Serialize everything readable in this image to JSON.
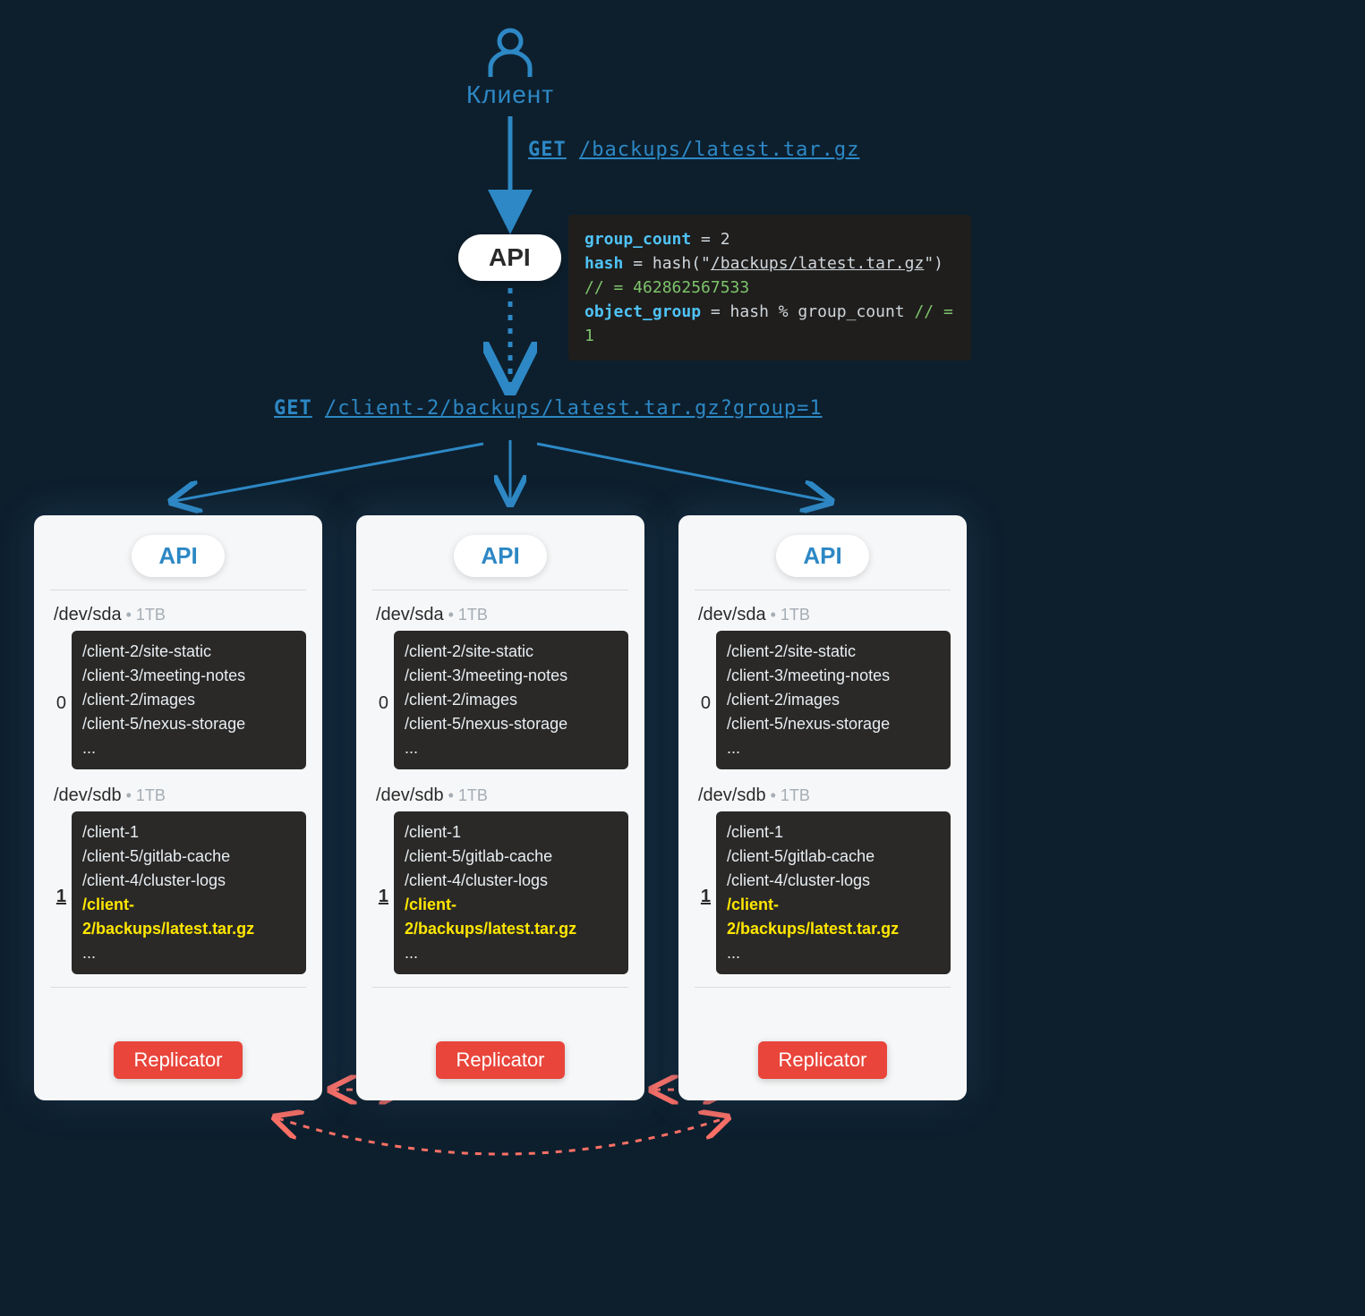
{
  "client": {
    "label": "Клиент"
  },
  "request1": {
    "method": "GET",
    "path": "/backups/latest.tar.gz"
  },
  "code": {
    "l1k": "group_count",
    "l1v": " = 2",
    "l2k": "hash",
    "l2a": " = hash(\"",
    "l2p": "/backups/latest.tar.gz",
    "l2b": "\") ",
    "l2c": "// = 462862567533",
    "l3k": "object_group",
    "l3v": " = hash % group_count  ",
    "l3c": "// = 1"
  },
  "api_top": "API",
  "request2": {
    "method": "GET",
    "path": "/client-2/backups/latest.tar.gz?group=1"
  },
  "node": {
    "api": "API",
    "devA": {
      "name": "/dev/sda",
      "size": " • 1TB"
    },
    "devB": {
      "name": "/dev/sdb",
      "size": " • 1TB"
    },
    "grp0_idx": "0",
    "grp0": {
      "r1": "/client-2/site-static",
      "r2": "/client-3/meeting-notes",
      "r3": "/client-2/images",
      "r4": "/client-5/nexus-storage",
      "r5": "..."
    },
    "grp1_idx": "1",
    "grp1": {
      "r1": "/client-1",
      "r2": "/client-5/gitlab-cache",
      "r3": "/client-4/cluster-logs",
      "r4": "/client-2/backups/latest.tar.gz",
      "r5": "..."
    },
    "replicator": "Replicator"
  }
}
